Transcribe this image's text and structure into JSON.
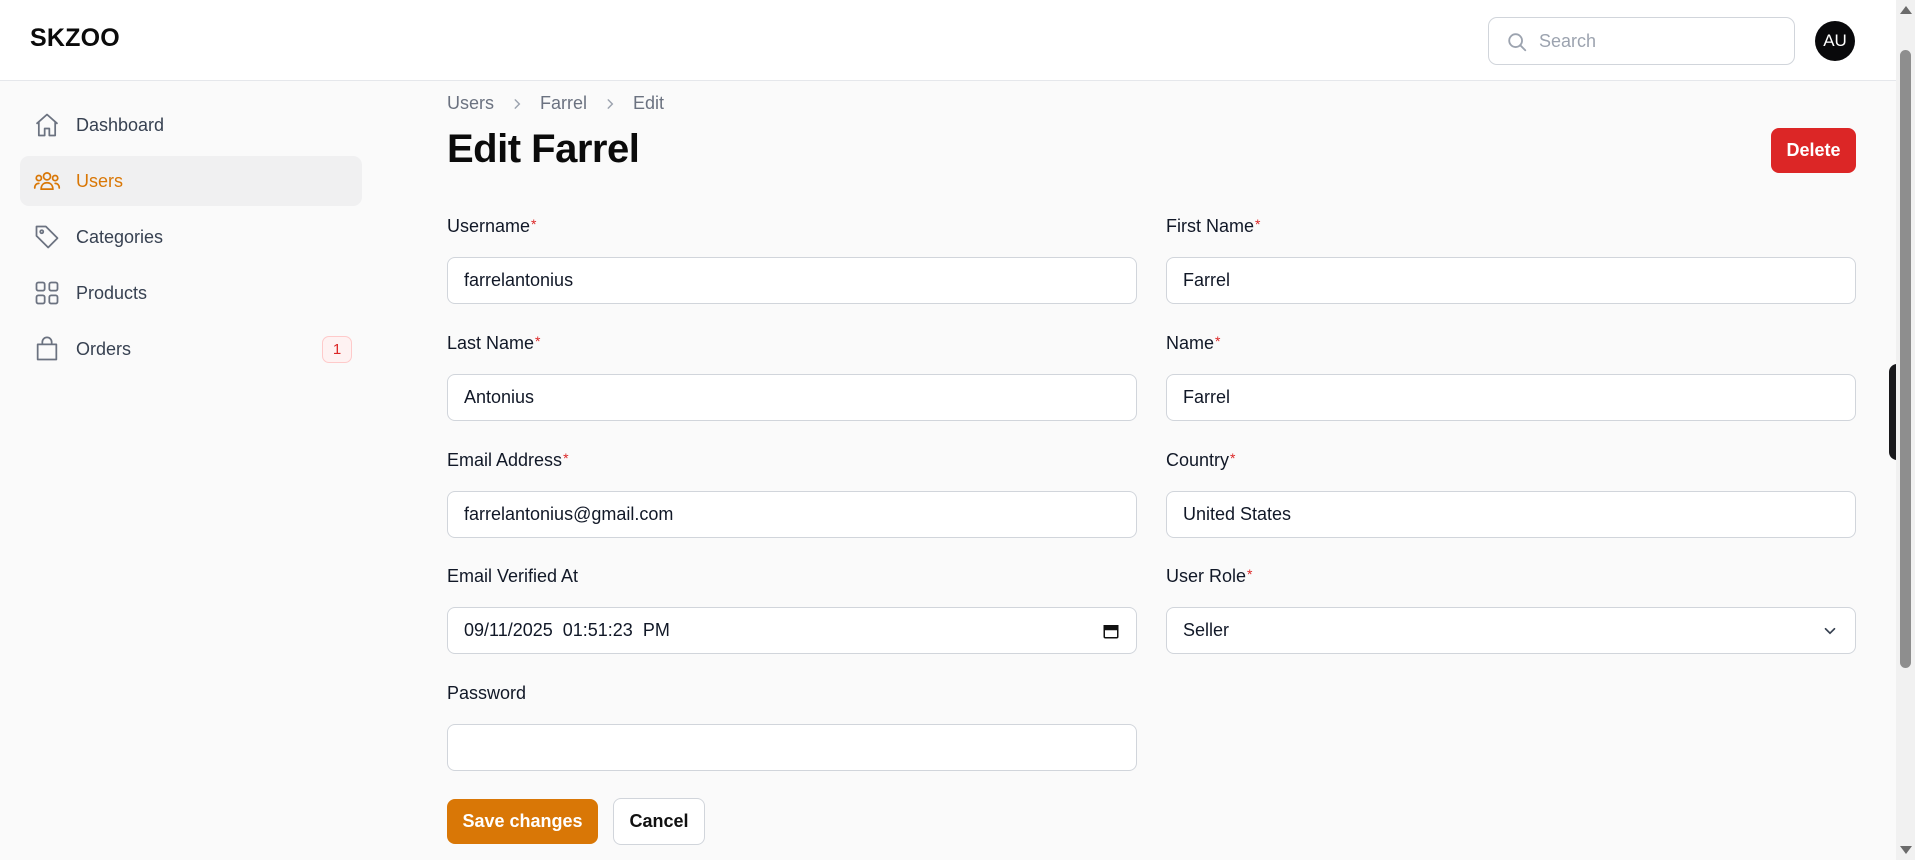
{
  "app": {
    "brand": "SKZOO"
  },
  "header": {
    "search_placeholder": "Search",
    "avatar_initials": "AU"
  },
  "sidebar": {
    "items": [
      {
        "label": "Dashboard",
        "icon": "home-icon",
        "active": false
      },
      {
        "label": "Users",
        "icon": "users-icon",
        "active": true
      },
      {
        "label": "Categories",
        "icon": "tag-icon",
        "active": false
      },
      {
        "label": "Products",
        "icon": "grid-icon",
        "active": false
      },
      {
        "label": "Orders",
        "icon": "shopping-bag-icon",
        "active": false,
        "badge": "1"
      }
    ]
  },
  "breadcrumb": [
    "Users",
    "Farrel",
    "Edit"
  ],
  "page": {
    "title": "Edit Farrel",
    "delete_label": "Delete"
  },
  "form": {
    "username": {
      "label": "Username",
      "value": "farrelantonius",
      "required": "*"
    },
    "first_name": {
      "label": "First Name",
      "value": "Farrel",
      "required": "*"
    },
    "last_name": {
      "label": "Last Name",
      "value": "Antonius",
      "required": "*"
    },
    "name": {
      "label": "Name",
      "value": "Farrel",
      "required": "*"
    },
    "email": {
      "label": "Email Address",
      "value": "farrelantonius@gmail.com",
      "required": "*"
    },
    "country": {
      "label": "Country",
      "value": "United States",
      "required": "*"
    },
    "email_verified_at": {
      "label": "Email Verified At",
      "value": "09/11/2025  01:51:23  PM"
    },
    "user_role": {
      "label": "User Role",
      "value": "Seller",
      "required": "*"
    },
    "password": {
      "label": "Password",
      "value": ""
    }
  },
  "actions": {
    "save_label": "Save changes",
    "cancel_label": "Cancel"
  },
  "colors": {
    "accent": "#d97706",
    "danger": "#dc2626",
    "background": "#fafafa"
  }
}
